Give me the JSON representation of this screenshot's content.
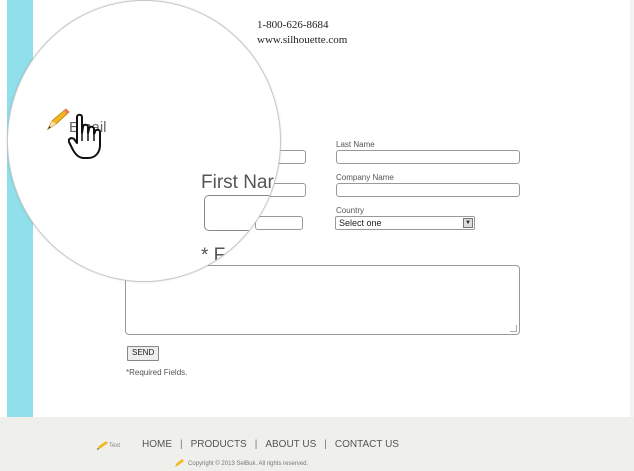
{
  "header": {
    "phone": "1-800-626-8684",
    "website": "www.silhouette.com"
  },
  "form": {
    "last_name_label": "Last Name",
    "company_name_label": "Company Name",
    "country_label": "Country",
    "country_selected": "Select one",
    "send_label": "SEND",
    "required_note": "*Required Fields."
  },
  "magnifier": {
    "email_label": "Email",
    "first_name_label": "First Nar",
    "message_label": "* F"
  },
  "footer": {
    "logo_text": "Text",
    "nav": [
      "HOME",
      "PRODUCTS",
      "ABOUT US",
      "CONTACT US"
    ],
    "copyright": "Copyright © 2013 SelBuk. All rights reserved."
  },
  "colors": {
    "accent_bar": "#8fe0ea",
    "footer_bg": "#efefec",
    "pencil_yellow": "#f2b824"
  },
  "icons": [
    "pencil-icon",
    "hand-cursor-icon",
    "select-arrow-icon"
  ]
}
